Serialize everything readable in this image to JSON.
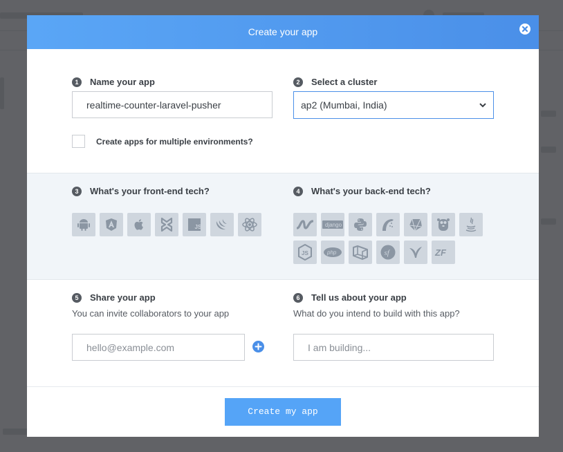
{
  "modal": {
    "title": "Create your app"
  },
  "step1": {
    "number": "1",
    "label": "Name your app",
    "app_name_value": "realtime-counter-laravel-pusher",
    "multi_env_label": "Create apps for multiple environments?",
    "multi_env_checked": false
  },
  "step2": {
    "number": "2",
    "label": "Select a cluster",
    "selected": "ap2 (Mumbai, India)"
  },
  "step3": {
    "number": "3",
    "label": "What's your front-end tech?",
    "techs": [
      "android-icon",
      "angular-icon",
      "apple-icon",
      "backbone-icon",
      "javascript-icon",
      "jquery-icon",
      "react-icon"
    ]
  },
  "step4": {
    "number": "4",
    "label": "What's your back-end tech?",
    "techs": [
      "dotnet-icon",
      "django-icon",
      "python-icon",
      "rails-icon",
      "ruby-icon",
      "go-icon",
      "java-icon",
      "nodejs-icon",
      "php-icon",
      "laravel-icon",
      "symfony-icon",
      "yii-icon",
      "zend-icon"
    ],
    "django_text": "django",
    "php_text": "php",
    "js_text": "JS",
    "sf_text": "sf",
    "zf_text": "ZF"
  },
  "step5": {
    "number": "5",
    "label": "Share your app",
    "sub": "You can invite collaborators to your app",
    "email_placeholder": "hello@example.com"
  },
  "step6": {
    "number": "6",
    "label": "Tell us about your app",
    "sub": "What do you intend to build with this app?",
    "build_placeholder": "I am building..."
  },
  "footer": {
    "create_label": "Create my app"
  },
  "colors": {
    "accent": "#4a8fe8",
    "button": "#55a4f7",
    "icon_bg": "#cfd6de",
    "icon_fg": "#8b96a3"
  }
}
